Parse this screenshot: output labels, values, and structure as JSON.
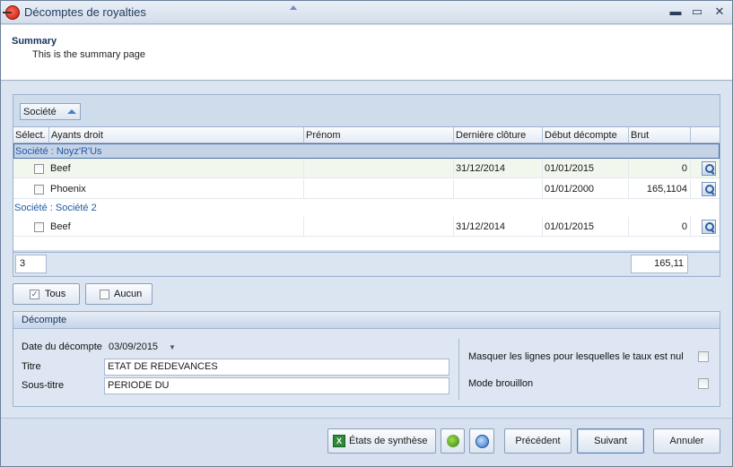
{
  "window": {
    "title": "Décomptes de royalties",
    "minimize": "▬",
    "maximize": "▭",
    "close": "✕"
  },
  "header": {
    "title": "Summary",
    "subtitle": "This is the summary page"
  },
  "grouping": {
    "chip_label": "Société"
  },
  "grid": {
    "columns": [
      "Sélect.",
      "Ayants droit",
      "Prénom",
      "Dernière clôture",
      "Début décompte",
      "Brut"
    ],
    "groups": [
      {
        "label": "Société : Noyz'R'Us",
        "rows": [
          {
            "name": "Beef",
            "prenom": "",
            "derniere_cloture": "31/12/2014",
            "debut_decompte": "01/01/2015",
            "brut": "0"
          },
          {
            "name": "Phoenix",
            "prenom": "",
            "derniere_cloture": "",
            "debut_decompte": "01/01/2000",
            "brut": "165,1104"
          }
        ]
      },
      {
        "label": "Société : Société 2",
        "rows": [
          {
            "name": "Beef",
            "prenom": "",
            "derniere_cloture": "31/12/2014",
            "debut_decompte": "01/01/2015",
            "brut": "0"
          }
        ]
      }
    ],
    "footer": {
      "count": "3",
      "total_brut": "165,11"
    }
  },
  "selection": {
    "all_label": "Tous",
    "none_label": "Aucun"
  },
  "decompte": {
    "title": "Décompte",
    "date_label": "Date du décompte",
    "date_value": "03/09/2015",
    "titre_label": "Titre",
    "titre_value": "ETAT DE REDEVANCES",
    "soustitre_label": "Sous-titre",
    "soustitre_value": "PERIODE DU",
    "mask_label": "Masquer les lignes pour lesquelles le taux est nul",
    "draft_label": "Mode brouillon"
  },
  "buttons": {
    "etats": "États de synthèse",
    "precedent": "Précédent",
    "suivant": "Suivant",
    "annuler": "Annuler"
  },
  "colors": {
    "accent": "#4a6fa5",
    "group_text": "#1f5aa8",
    "selected_row": "#f1f7ec"
  }
}
